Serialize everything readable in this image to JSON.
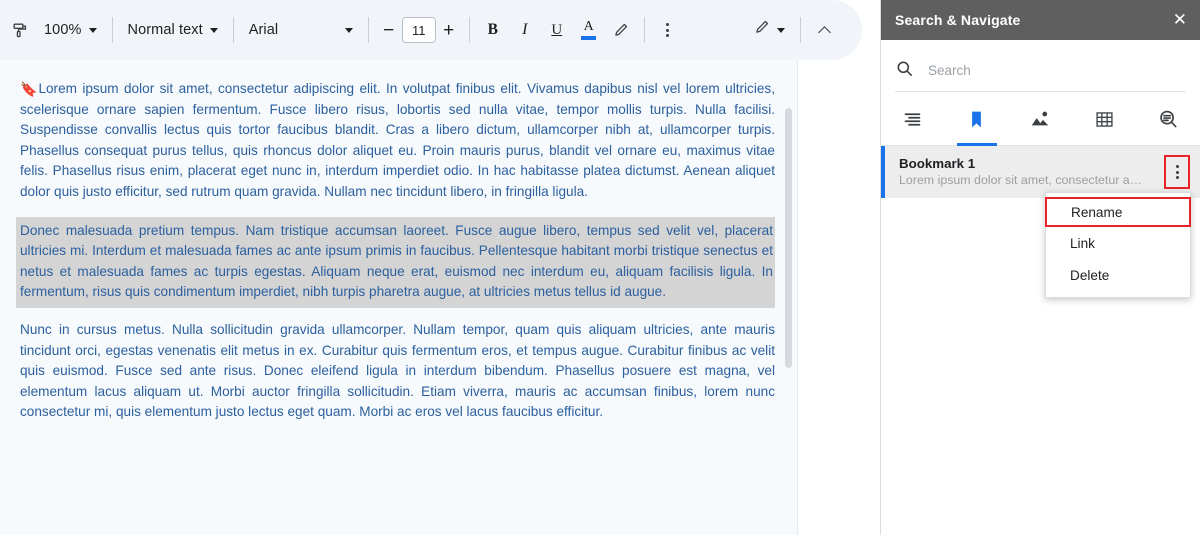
{
  "toolbar": {
    "format_painter_icon": "paint-roller-icon",
    "zoom_value": "100%",
    "style_value": "Normal text",
    "font_value": "Arial",
    "font_size_decrease": "−",
    "font_size_value": "11",
    "font_size_increase": "+",
    "bold_label": "B",
    "italic_label": "I",
    "underline_label": "U",
    "text_color_label": "A",
    "highlight_icon": "highlighter-pen-icon",
    "more_options_icon": "more-vertical-icon",
    "edit_mode_icon": "pencil-icon",
    "edit_mode_caret_icon": "chevron-down-icon",
    "collapse_icon": "chevron-up-icon"
  },
  "document": {
    "bookmark_marker_icon": "bookmark-icon",
    "paragraphs": [
      {
        "id": "p1",
        "highlighted": false,
        "text": "Lorem ipsum dolor sit amet, consectetur adipiscing elit. In volutpat finibus elit. Vivamus dapibus nisl vel lorem ultricies, scelerisque ornare sapien fermentum. Fusce libero risus, lobortis sed nulla vitae, tempor mollis turpis. Nulla facilisi. Suspendisse convallis lectus quis tortor faucibus blandit. Cras a libero dictum, ullamcorper nibh at, ullamcorper turpis. Phasellus consequat purus tellus, quis rhoncus dolor aliquet eu. Proin mauris purus, blandit vel ornare eu, maximus vitae felis. Phasellus risus enim, placerat eget nunc in, interdum imperdiet odio. In hac habitasse platea dictumst. Aenean aliquet dolor quis justo efficitur, sed rutrum quam gravida. Nullam nec tincidunt libero, in fringilla ligula."
      },
      {
        "id": "p2",
        "highlighted": true,
        "text": "Donec malesuada pretium tempus. Nam tristique accumsan laoreet. Fusce augue libero, tempus sed velit vel, placerat ultricies mi. Interdum et malesuada fames ac ante ipsum primis in faucibus. Pellentesque habitant morbi tristique senectus et netus et malesuada fames ac turpis egestas. Aliquam neque erat, euismod nec interdum eu, aliquam facilisis ligula. In fermentum, risus quis condimentum imperdiet, nibh turpis pharetra augue, at ultricies metus tellus id augue."
      },
      {
        "id": "p3",
        "highlighted": false,
        "text": "Nunc in cursus metus. Nulla sollicitudin gravida ullamcorper. Nullam tempor, quam quis aliquam ultricies, ante mauris tincidunt orci, egestas venenatis elit metus in ex. Curabitur quis fermentum eros, et tempus augue. Curabitur finibus ac velit quis euismod. Fusce sed ante risus. Donec eleifend ligula in interdum bibendum. Phasellus posuere est magna, vel elementum lacus aliquam ut. Morbi auctor fringilla sollicitudin. Etiam viverra, mauris ac accumsan finibus, lorem nunc consectetur mi, quis elementum justo lectus eget quam. Morbi ac eros vel lacus faucibus efficitur."
      }
    ],
    "scrollbar_name": "document-scrollbar"
  },
  "panel": {
    "title": "Search & Navigate",
    "close_icon": "close-icon",
    "search": {
      "icon": "search-icon",
      "value": "",
      "placeholder": "Search"
    },
    "tabs": [
      {
        "id": "outline",
        "icon": "outline-icon",
        "active": false
      },
      {
        "id": "bookmarks",
        "icon": "bookmark-icon",
        "active": true
      },
      {
        "id": "images",
        "icon": "image-icon",
        "active": false
      },
      {
        "id": "tables",
        "icon": "table-icon",
        "active": false
      },
      {
        "id": "find",
        "icon": "search-document-icon",
        "active": false
      }
    ],
    "bookmarks": [
      {
        "title": "Bookmark 1",
        "preview": "Lorem ipsum dolor sit amet, consectetur adipisc...",
        "selected": true,
        "kebab_icon": "more-vertical-icon"
      }
    ],
    "context_menu": {
      "items": [
        {
          "label": "Rename",
          "highlighted": true
        },
        {
          "label": "Link",
          "highlighted": false
        },
        {
          "label": "Delete",
          "highlighted": false
        }
      ]
    }
  },
  "colors": {
    "accent_blue": "#1a73e8",
    "panel_header_gray": "#5f5f5f",
    "highlight_red": "#e8242a",
    "document_text_blue": "#2b5f9e",
    "selection_gray": "#d4d4d4"
  }
}
